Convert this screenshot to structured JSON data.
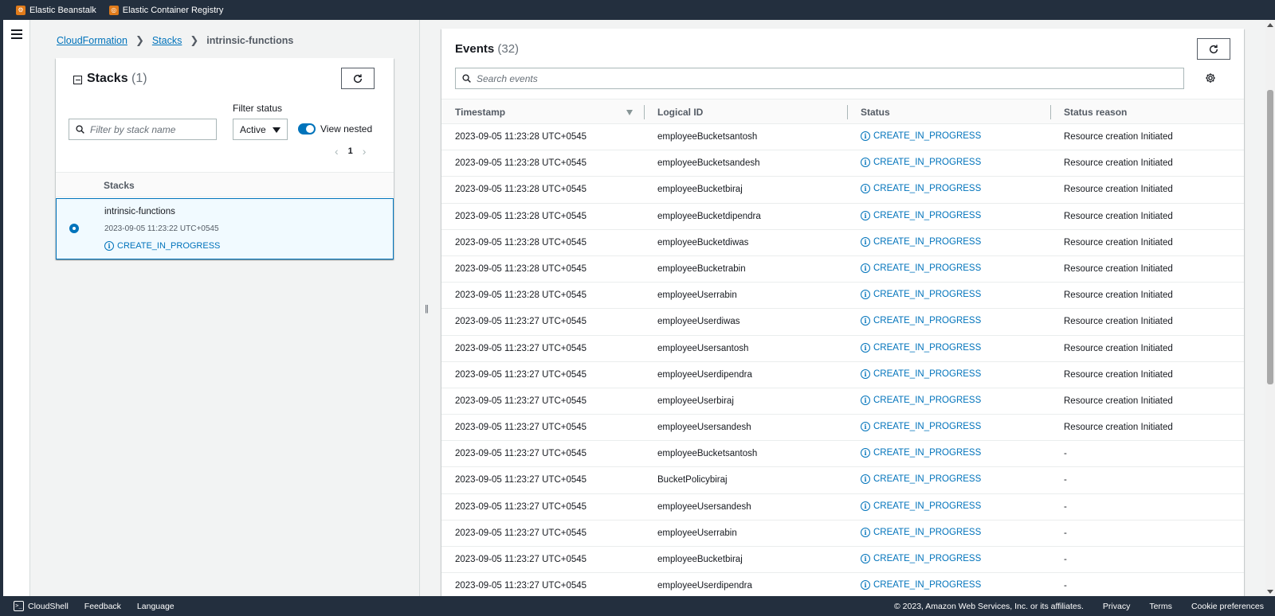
{
  "favorites": [
    {
      "label": "Elastic Beanstalk",
      "icon": "elastic-beanstalk-icon"
    },
    {
      "label": "Elastic Container Registry",
      "icon": "ecr-icon"
    }
  ],
  "breadcrumb": {
    "items": [
      "CloudFormation",
      "Stacks"
    ],
    "current": "intrinsic-functions"
  },
  "stacks_panel": {
    "title": "Stacks",
    "count": "(1)",
    "search_placeholder": "Filter by stack name",
    "filter_label": "Filter status",
    "filter_value": "Active",
    "toggle_label": "View nested",
    "page": "1",
    "column_header": "Stacks",
    "stack": {
      "name": "intrinsic-functions",
      "time": "2023-09-05 11:23:22 UTC+0545",
      "status": "CREATE_IN_PROGRESS"
    }
  },
  "events_panel": {
    "title": "Events",
    "count": "(32)",
    "search_placeholder": "Search events",
    "columns": [
      "Timestamp",
      "Logical ID",
      "Status",
      "Status reason"
    ],
    "rows": [
      {
        "timestamp": "2023-09-05 11:23:28 UTC+0545",
        "logical_id": "employeeBucketsantosh",
        "status": "CREATE_IN_PROGRESS",
        "reason": "Resource creation Initiated"
      },
      {
        "timestamp": "2023-09-05 11:23:28 UTC+0545",
        "logical_id": "employeeBucketsandesh",
        "status": "CREATE_IN_PROGRESS",
        "reason": "Resource creation Initiated"
      },
      {
        "timestamp": "2023-09-05 11:23:28 UTC+0545",
        "logical_id": "employeeBucketbiraj",
        "status": "CREATE_IN_PROGRESS",
        "reason": "Resource creation Initiated"
      },
      {
        "timestamp": "2023-09-05 11:23:28 UTC+0545",
        "logical_id": "employeeBucketdipendra",
        "status": "CREATE_IN_PROGRESS",
        "reason": "Resource creation Initiated"
      },
      {
        "timestamp": "2023-09-05 11:23:28 UTC+0545",
        "logical_id": "employeeBucketdiwas",
        "status": "CREATE_IN_PROGRESS",
        "reason": "Resource creation Initiated"
      },
      {
        "timestamp": "2023-09-05 11:23:28 UTC+0545",
        "logical_id": "employeeBucketrabin",
        "status": "CREATE_IN_PROGRESS",
        "reason": "Resource creation Initiated"
      },
      {
        "timestamp": "2023-09-05 11:23:28 UTC+0545",
        "logical_id": "employeeUserrabin",
        "status": "CREATE_IN_PROGRESS",
        "reason": "Resource creation Initiated"
      },
      {
        "timestamp": "2023-09-05 11:23:27 UTC+0545",
        "logical_id": "employeeUserdiwas",
        "status": "CREATE_IN_PROGRESS",
        "reason": "Resource creation Initiated"
      },
      {
        "timestamp": "2023-09-05 11:23:27 UTC+0545",
        "logical_id": "employeeUsersantosh",
        "status": "CREATE_IN_PROGRESS",
        "reason": "Resource creation Initiated"
      },
      {
        "timestamp": "2023-09-05 11:23:27 UTC+0545",
        "logical_id": "employeeUserdipendra",
        "status": "CREATE_IN_PROGRESS",
        "reason": "Resource creation Initiated"
      },
      {
        "timestamp": "2023-09-05 11:23:27 UTC+0545",
        "logical_id": "employeeUserbiraj",
        "status": "CREATE_IN_PROGRESS",
        "reason": "Resource creation Initiated"
      },
      {
        "timestamp": "2023-09-05 11:23:27 UTC+0545",
        "logical_id": "employeeUsersandesh",
        "status": "CREATE_IN_PROGRESS",
        "reason": "Resource creation Initiated"
      },
      {
        "timestamp": "2023-09-05 11:23:27 UTC+0545",
        "logical_id": "employeeBucketsantosh",
        "status": "CREATE_IN_PROGRESS",
        "reason": "-"
      },
      {
        "timestamp": "2023-09-05 11:23:27 UTC+0545",
        "logical_id": "BucketPolicybiraj",
        "status": "CREATE_IN_PROGRESS",
        "reason": "-"
      },
      {
        "timestamp": "2023-09-05 11:23:27 UTC+0545",
        "logical_id": "employeeUsersandesh",
        "status": "CREATE_IN_PROGRESS",
        "reason": "-"
      },
      {
        "timestamp": "2023-09-05 11:23:27 UTC+0545",
        "logical_id": "employeeUserrabin",
        "status": "CREATE_IN_PROGRESS",
        "reason": "-"
      },
      {
        "timestamp": "2023-09-05 11:23:27 UTC+0545",
        "logical_id": "employeeBucketbiraj",
        "status": "CREATE_IN_PROGRESS",
        "reason": "-"
      },
      {
        "timestamp": "2023-09-05 11:23:27 UTC+0545",
        "logical_id": "employeeUserdipendra",
        "status": "CREATE_IN_PROGRESS",
        "reason": "-"
      }
    ]
  },
  "footer": {
    "cloudshell": "CloudShell",
    "feedback": "Feedback",
    "language": "Language",
    "copyright": "© 2023, Amazon Web Services, Inc. or its affiliates.",
    "privacy": "Privacy",
    "terms": "Terms",
    "cookies": "Cookie preferences"
  },
  "colors": {
    "link": "#0073bb",
    "header_bg": "#232f3e",
    "favorite_icon": "#e07b1a",
    "selected_row_bg": "#f1faff"
  }
}
